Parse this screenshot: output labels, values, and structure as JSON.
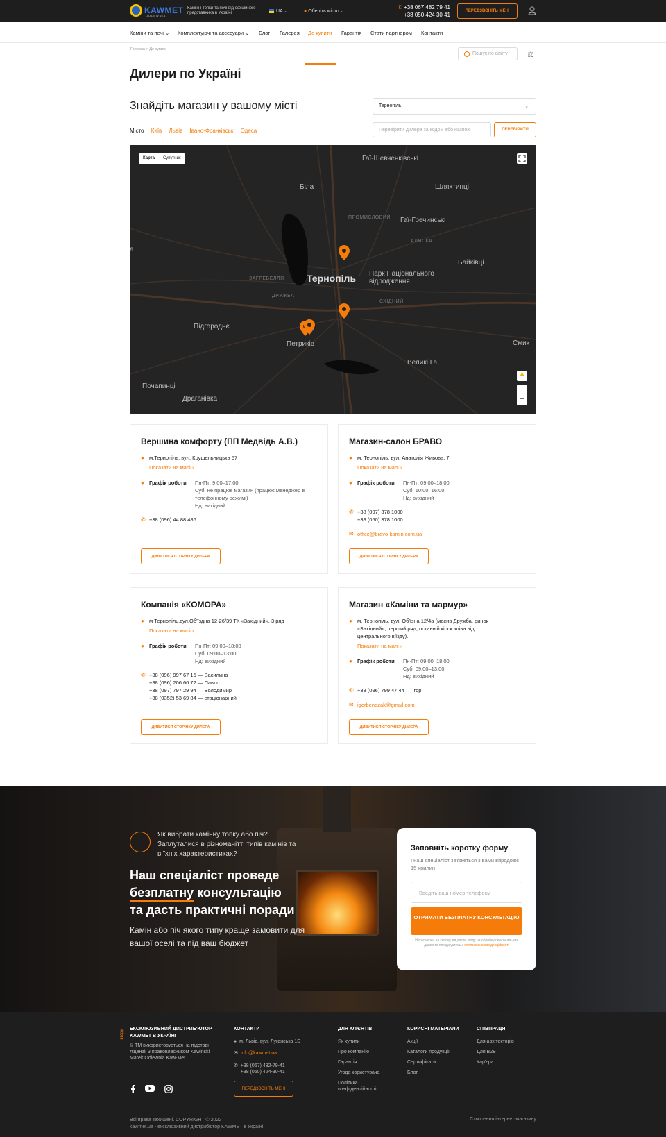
{
  "header": {
    "logo_text": "KAWMET",
    "logo_sub": "ODLEWNIA",
    "tagline": "Камінні топки та печі від офіційного представника в Україні",
    "lang": "UA",
    "city_select": "Оберіть місто",
    "phone1": "+38 067 482 79 41",
    "phone2": "+38 050 424 30 41",
    "call_button": "ПЕРЕДЗВОНІТЬ МЕНІ"
  },
  "nav": {
    "items": [
      "Каміни та печі",
      "Комплектуючі та аксесуари",
      "Блог",
      "Галерея",
      "Де купити",
      "Гарантія",
      "Стати партнером",
      "Контакти"
    ],
    "search_placeholder": "Пошук по сайту"
  },
  "breadcrumb": {
    "home": "Головна",
    "sep": ">",
    "current": "Де купити"
  },
  "page": {
    "title": "Дилери по Україні",
    "find_title": "Знайдіть магазин у вашому місті",
    "city_value": "Тернопіль",
    "city_label": "Місто",
    "quick_cities": [
      "Київ",
      "Львів",
      "Івано-Франківськ",
      "Одеса"
    ],
    "dealer_placeholder": "Перевірити дилера за кодом або назвою",
    "check_button": "ПЕРЕВІРИТИ"
  },
  "map": {
    "tab_map": "Карта",
    "tab_sat": "Супутник",
    "labels": {
      "gai": "Гаї-Шевченківські",
      "bila": "Біла",
      "shlyakh": "Шляхтинці",
      "promysl": "ПРОМИСЛОВИЙ",
      "gaigrech": "Гаї-Гречинські",
      "alyaska": "АЛЯСКА",
      "baikivtsi": "Байківці",
      "ternopil": "Тернопіль",
      "park": "Парк Національного відродження",
      "zagreb": "ЗАГРЕБЕЛЛЯ",
      "druzhba": "ДРУЖБА",
      "skhidnyi": "СХІДНИЙ",
      "pidgor": "Підгороднє",
      "petrykiv": "Петриків",
      "smyk": "Смик",
      "velyki": "Великі Гаї",
      "pochap": "Почапинці",
      "drag": "Драганівка",
      "edge": "а"
    },
    "zoom_in": "+",
    "zoom_out": "−"
  },
  "dealers": [
    {
      "name": "Вершина комфорту (ПП Медвідь А.В.)",
      "address": "м.Тернопіль, вул. Крушельницька 57",
      "show_map": "Показати на мапі",
      "schedule_label": "Графік роботи",
      "schedule": [
        "Пн-Пт: 9:00–17:00",
        "Суб: не працює магазин (працює менеджер в телефонному режимі)",
        "Нд: вихідний"
      ],
      "phones": [
        "+38 (096) 44 88 486"
      ],
      "email": "",
      "button": "ДИВИТИСЯ СТОРІНКУ ДИЛЕРА"
    },
    {
      "name": "Магазин-салон БРАВО",
      "address": "м. Тернопіль, вул. Анатолія Живова, 7",
      "show_map": "Показати на мапі",
      "schedule_label": "Графік роботи",
      "schedule": [
        "Пн-Пт: 09:00–18:00",
        "Суб: 10:00–16:00",
        "Нд: вихідний"
      ],
      "phones": [
        "+38 (097) 378 1000",
        "+38 (050) 378 1000"
      ],
      "email": "office@bravo-kamin.com.ua",
      "button": "ДИВИТИСЯ СТОРІНКУ ДИЛЕРА"
    },
    {
      "name": "Компанія «КОМОРА»",
      "address": "м Тернопіль,вул.Об'їздна 12-26/39 ТК «Західний», 3 ряд",
      "show_map": "Показати на мапі",
      "schedule_label": "Графік роботи",
      "schedule": [
        "Пн-Пт: 09:00–18:00",
        "Суб: 09:00–13:00",
        "Нд: вихідний"
      ],
      "phones": [
        "+38 (096) 997 67 15",
        "+38 (096) 206 66 72",
        "+38 (097) 797 29 94",
        "+38 (0352) 53 69 84"
      ],
      "phone_notes": [
        "— Василина",
        "— Павло",
        "— Володимир",
        "— стаціонарний"
      ],
      "email": "",
      "button": "ДИВИТИСЯ СТОРІНКУ ДИЛЕРА"
    },
    {
      "name": "Магазин «Каміни та мармур»",
      "address": "м. Тернопіль, вул. Об'їзна 12/4а (масив Дружба, ринок «Західний», перший ряд, останній кіоск зліва від центрального в'їзду).",
      "show_map": "Показати на мапі",
      "schedule_label": "Графік роботи",
      "schedule": [
        "Пн-Пт: 09:00–18:00",
        "Суб: 09:00–13:00",
        "Нд: вихідний"
      ],
      "phones": [
        "+38 (096) 799 47 44"
      ],
      "phone_notes": [
        "— Ігор"
      ],
      "email": "igorbendzak@gmail.com",
      "button": "ДИВИТИСЯ СТОРІНКУ ДИЛЕРА"
    }
  ],
  "promo": {
    "question": "Як вибрати камінну топку або піч? Заплуталися в різноманітті типів камінів та в їхніх характеристиках?",
    "headline_1": "Наш спеціаліст проведе",
    "headline_2a": "безплатну",
    "headline_2b": " консультацію",
    "headline_3": "та дасть практичні поради",
    "sub": "Камін або піч якого типу краще замовити для вашої оселі та під ваш бюджет",
    "form_title": "Заповніть коротку форму",
    "form_sub": "І наш спеціаліст зв'яжеться з вами впродовж 15 хвилин",
    "form_placeholder": "Введіть ваш номер телефону",
    "form_button": "ОТРИМАТИ БЕЗПЛАТНУ КОНСУЛЬТАЦІЮ",
    "form_note": "Натискаючи на кнопку, ви даєте згоду на обробку персональних даних та погоджуєтесь з",
    "form_note_link": "політикою конфіденційності"
  },
  "footer": {
    "up": "вгору",
    "dist_title": "ЕКСКЛЮЗИВНИЙ ДИСТРИБ'ЮТОР KAWMET В УКРАЇНІ",
    "dist_text": "© ТМ використовується на підставі ліцензії 3 правовласником Kawiński Marek Odlewnia Kaw-Met",
    "contacts_title": "КОНТАКТИ",
    "address": "м. Львів, вул. Луганська 1Б",
    "email": "info@kawmet.ua",
    "phone1": "+38 (067) 482-79-41",
    "phone2": "+38 (050) 424-30-41",
    "call_button": "ПЕРЕДЗВОНІТЬ МЕНІ",
    "clients_title": "ДЛЯ КЛІЄНТІВ",
    "clients": [
      "Як купити",
      "Про компанію",
      "Гарантія",
      "Угода користувача",
      "Політика конфіденційності"
    ],
    "useful_title": "КОРИСНІ МАТЕРІАЛИ",
    "useful": [
      "Акції",
      "Каталоги продукції",
      "Сертифікати",
      "Блог"
    ],
    "coop_title": "СПІВПРАЦЯ",
    "coop": [
      "Для архітекторів",
      "Для B2B",
      "Кар'єра"
    ],
    "copy1": "Всі права захищені. COPYRIGHT © 2022",
    "copy2": "kawmet.ua - ексклюзивний дистрибютор KAWMET в Україні",
    "made": "Створення інтернет-магазину"
  }
}
